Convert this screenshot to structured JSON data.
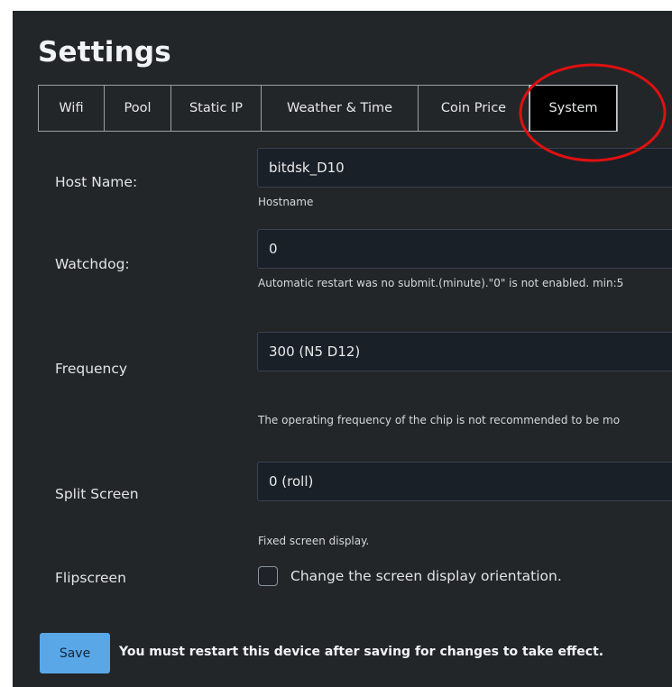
{
  "page": {
    "title": "Settings"
  },
  "tabs": [
    {
      "label": "Wifi"
    },
    {
      "label": "Pool"
    },
    {
      "label": "Static IP"
    },
    {
      "label": "Weather & Time"
    },
    {
      "label": "Coin Price"
    },
    {
      "label": "System",
      "active": true
    }
  ],
  "form": {
    "host_name": {
      "label": "Host Name:",
      "value": "bitdsk_D10",
      "help": "Hostname"
    },
    "watchdog": {
      "label": "Watchdog:",
      "value": "0",
      "help": "Automatic restart was no submit.(minute).\"0\" is not enabled. min:5"
    },
    "frequency": {
      "label": "Frequency",
      "value": "300 (N5 D12)",
      "help": "The operating frequency of the chip is not recommended to be mo"
    },
    "split_screen": {
      "label": "Split Screen",
      "value": "0 (roll)",
      "help": "Fixed screen display."
    },
    "flipscreen": {
      "label": "Flipscreen",
      "checkbox_label": "Change the screen display orientation.",
      "checked": false
    }
  },
  "footer": {
    "save_label": "Save",
    "restart_note": "You must restart this device after saving for changes to take effect."
  },
  "colors": {
    "panel_bg": "#222629",
    "input_bg": "#1a2027",
    "save_button": "#5aa7e8",
    "active_tab": "#000000",
    "highlight_circle": "#e01010"
  }
}
